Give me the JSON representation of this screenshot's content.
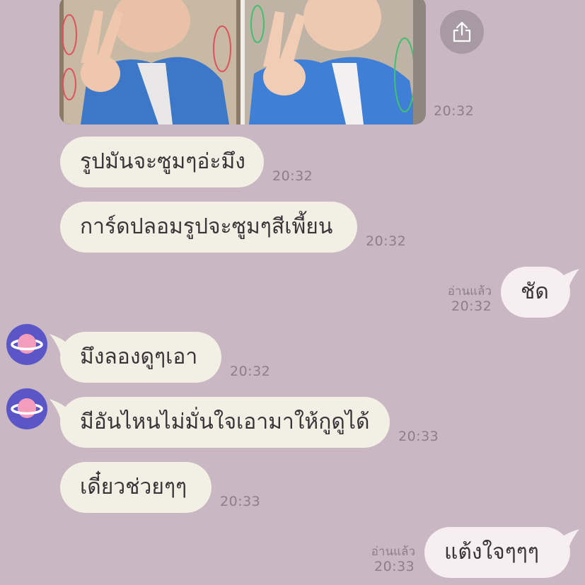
{
  "colors": {
    "background": "#c9b8c3",
    "incoming_bubble": "#f2efe5",
    "outgoing_bubble": "#f6eef0",
    "avatar": "#5a56c8",
    "timestamp": "#8e7e89"
  },
  "photo": {
    "time": "20:32"
  },
  "share_icon": "share-icon",
  "messages": [
    {
      "side": "in",
      "text": "รูปมันจะซูมๆอ่ะมึง",
      "time": "20:32"
    },
    {
      "side": "in",
      "text": "การ์ดปลอมรูปจะซูมๆสีเพี้ยน",
      "time": "20:32"
    },
    {
      "side": "out",
      "text": "ชัด",
      "time": "20:32",
      "read": "อ่านแล้ว"
    },
    {
      "side": "in",
      "text": "มึงลองดูๆเอา",
      "time": "20:32",
      "avatar": "planet-icon"
    },
    {
      "side": "in",
      "text": "มีอันไหนไม่มั่นใจเอามาให้กูดูได้",
      "time": "20:33",
      "avatar": "planet-icon"
    },
    {
      "side": "in",
      "text": "เดี๋ยวช่วยๆๆ",
      "time": "20:33"
    },
    {
      "side": "out",
      "text": "แต้งใจๆๆๆ",
      "time": "20:33",
      "read": "อ่านแล้ว"
    }
  ]
}
